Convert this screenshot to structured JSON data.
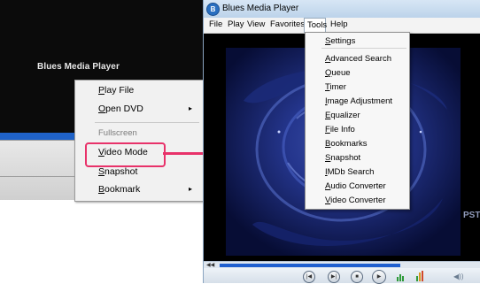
{
  "left_window": {
    "title": "Blues Media Player",
    "context_menu": {
      "items": [
        {
          "underline": "P",
          "rest": "lay File",
          "submenu": false,
          "enabled": true
        },
        {
          "underline": "O",
          "rest": "pen DVD",
          "submenu": true,
          "enabled": true
        },
        {
          "label": "Fullscreen",
          "enabled": false
        },
        {
          "underline": "V",
          "rest": "ideo Mode",
          "submenu": false,
          "enabled": true,
          "highlighted": true
        },
        {
          "underline": "S",
          "rest": "napshot",
          "submenu": false,
          "enabled": true
        },
        {
          "underline": "B",
          "rest": "ookmark",
          "submenu": true,
          "enabled": true
        }
      ],
      "submenu_arrow": "▸",
      "highlight_color": "#e8326a"
    }
  },
  "right_window": {
    "title": "Blues Media Player",
    "app_icon": "blue-circle-b",
    "menu": [
      "File",
      "Play",
      "View",
      "Favorites",
      "Tools",
      "Help"
    ],
    "tools_menu": [
      {
        "underline": "S",
        "rest": "ettings"
      },
      {
        "underline": "A",
        "rest": "dvanced Search"
      },
      {
        "underline": "Q",
        "rest": "ueue"
      },
      {
        "underline": "T",
        "rest": "imer"
      },
      {
        "underline": "I",
        "rest": "mage Adjustment"
      },
      {
        "underline": "E",
        "rest": "qualizer"
      },
      {
        "underline": "F",
        "rest": "ile Info"
      },
      {
        "underline": "B",
        "rest": "ookmarks"
      },
      {
        "underline": "S",
        "rest": "napshot"
      },
      {
        "underline": "I",
        "rest": "MDb Search"
      },
      {
        "underline": "A",
        "rest": "udio Converter"
      },
      {
        "underline": "V",
        "rest": "ideo Converter"
      }
    ],
    "watermark": "PST",
    "progress": 0.69,
    "controls": [
      "previous-icon",
      "next-icon",
      "stop-icon",
      "play-icon"
    ],
    "accent_color": "#1f5fcf"
  }
}
